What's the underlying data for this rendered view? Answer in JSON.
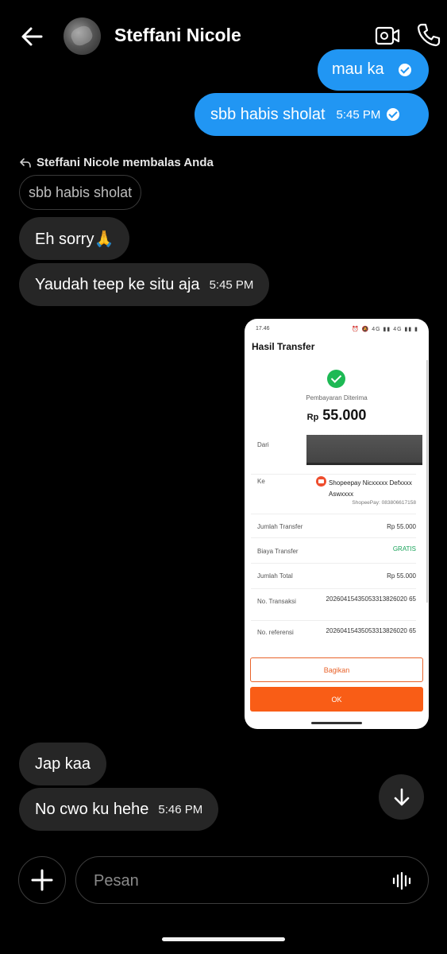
{
  "header": {
    "contact_name": "Steffani Nicole",
    "back_icon": "arrow-left-icon",
    "video_icon": "video-call-icon",
    "call_icon": "phone-icon"
  },
  "messages": {
    "partial_outgoing": {
      "text": "mau ka"
    },
    "outgoing_main": {
      "text": "sbb habis sholat",
      "time": "5:45 PM"
    },
    "reply_header": "Steffani Nicole membalas Anda",
    "quoted_text": "sbb habis sholat",
    "incoming_1": {
      "text": "Eh sorry🙏"
    },
    "incoming_2": {
      "text": "Yaudah teep ke situ aja",
      "time": "5:45 PM"
    },
    "incoming_3": {
      "text": "Jap kaa"
    },
    "incoming_4": {
      "text": "No cwo ku hehe",
      "time": "5:46 PM"
    }
  },
  "screenshot": {
    "status_time": "17.46",
    "status_icons": "⏰ 🔕 4G ▮▮ 4G ▮▮ ▮",
    "app_title": "Hasil Transfer",
    "status_label": "Pembayaran Diterima",
    "currency": "Rp",
    "amount": "55.000",
    "rows": {
      "dari_label": "Dari",
      "ke_label": "Ke",
      "recipient_name": "Shopeepay Nicxxxxx Defxxxx Aswxxxx",
      "recipient_id": "ShopeePay: 083806617158",
      "jumlah_transfer_label": "Jumlah Transfer",
      "jumlah_transfer_value": "Rp 55.000",
      "biaya_transfer_label": "Biaya Transfer",
      "biaya_transfer_value": "GRATIS",
      "jumlah_total_label": "Jumlah Total",
      "jumlah_total_value": "Rp 55.000",
      "no_transaksi_label": "No. Transaksi",
      "no_transaksi_value": "20260415435053313826020 65",
      "no_referensi_label": "No. referensi",
      "no_referensi_value": "20260415435053313826020 65"
    },
    "share_label": "Bagikan",
    "ok_label": "OK"
  },
  "composer": {
    "placeholder": "Pesan",
    "plus_icon": "plus-icon",
    "voice_icon": "voice-waveform-icon"
  },
  "colors": {
    "outgoing_bubble": "#2196f3",
    "incoming_bubble": "#262626",
    "background": "#000000"
  }
}
